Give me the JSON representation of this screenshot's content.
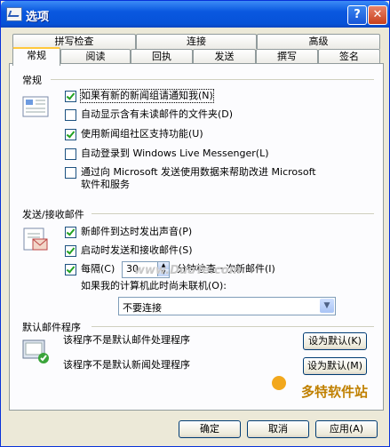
{
  "window": {
    "title": "选项"
  },
  "tabs_row1": [
    "拼写检查",
    "连接",
    "高级"
  ],
  "tabs_row2": [
    "常规",
    "阅读",
    "回执",
    "发送",
    "撰写",
    "签名"
  ],
  "sections": {
    "general": {
      "title": "常规",
      "options": [
        {
          "label": "如果有新的新闻组请通知我(N)",
          "checked": true
        },
        {
          "label": "自动显示含有未读邮件的文件夹(D)",
          "checked": false
        },
        {
          "label": "使用新闻组社区支持功能(U)",
          "checked": true
        },
        {
          "label": "自动登录到 Windows Live Messenger(L)",
          "checked": false
        },
        {
          "label": "通过向 Microsoft 发送使用数据来帮助改进 Microsoft",
          "label2": "软件和服务",
          "checked": false
        }
      ]
    },
    "send_receive": {
      "title": "发送/接收邮件",
      "options": [
        {
          "label": "新邮件到达时发出声音(P)",
          "checked": true
        },
        {
          "label": "启动时发送和接收邮件(S)",
          "checked": true
        }
      ],
      "every_label": "每隔(C)",
      "every_checked": true,
      "minutes_value": "30",
      "minutes_suffix": "分钟检查一次新邮件(I)",
      "offline_label": "如果我的计算机此时尚未联机(O):",
      "offline_selected": "不要连接"
    },
    "default_programs": {
      "title": "默认邮件程序",
      "mail_text": "该程序不是默认邮件处理程序",
      "mail_button": "设为默认(K)",
      "news_text": "该程序不是默认新闻处理程序",
      "news_button": "设为默认(M)"
    }
  },
  "buttons": {
    "ok": "确定",
    "cancel": "取消",
    "apply": "应用(A)"
  },
  "watermark": {
    "site": "www.DuoTe.com",
    "brand": "多特软件站"
  }
}
